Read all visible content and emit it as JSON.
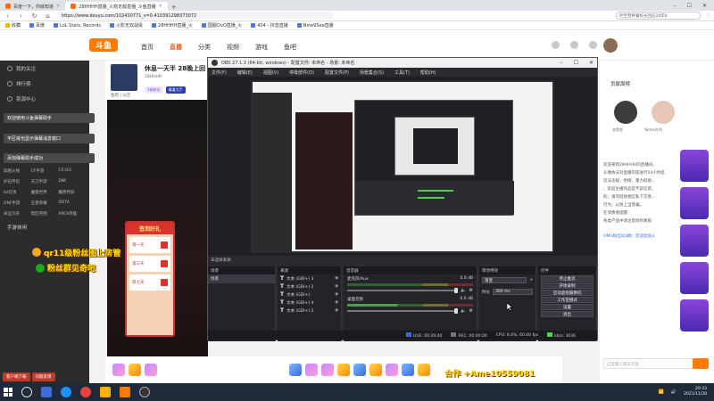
{
  "browser": {
    "tabs": [
      {
        "label": "百度一下，你就知道",
        "active": false
      },
      {
        "label": "28HHHH直播_火箭无敌直播_斗鱼直播",
        "active": true
      }
    ],
    "url": "https://www.douyu.com/102430771_s=0.410391298373072",
    "search_placeholder": "时至营养餐校长回应20年6",
    "bookmarks": [
      "收藏",
      "百度",
      "LoL Stats, Records",
      "火影无双战役",
      "28HHHH直播_火",
      "国服OvO直播_火",
      "404 - 抖音直播",
      "Nine95ee直播"
    ]
  },
  "site": {
    "logo": "斗鱼",
    "nav": [
      {
        "label": "首页",
        "active": false
      },
      {
        "label": "直播",
        "active": true
      },
      {
        "label": "分类",
        "active": false
      },
      {
        "label": "视频",
        "active": false
      },
      {
        "label": "游戏",
        "active": false
      },
      {
        "label": "鱼吧",
        "active": false
      }
    ]
  },
  "sidebar": {
    "items": [
      "我的关注",
      "排行榜",
      "资源中心"
    ],
    "toasts": [
      "欢迎使用斗鱼弹幕助手",
      "平区域也显示弹幕消息窗口",
      "添加弹幕助手成功"
    ],
    "categories": [
      "英雄联盟",
      "和平精英",
      "DOTA2",
      "穿越火线",
      "CF手游",
      "CS:GO",
      "炉石传说",
      "天刀手游",
      "DNF",
      "lol云顶",
      "魔兽世界",
      "魔兽怀旧",
      "DNF手游",
      "王者荣耀",
      "DOTA",
      "命运方舟",
      "暗区突围",
      "APEX英雄"
    ],
    "section_label": "手游休闲",
    "bottom_buttons": [
      "客户端下载",
      "问题反馈"
    ]
  },
  "stream": {
    "title": "休息一天半 28晚上回",
    "subtitle": "鱼吧 | 公告",
    "streamer": "28HHHH",
    "tags": [
      "5级粉丝",
      "福道大厅"
    ]
  },
  "overlay": {
    "gift_title": "签到好礼",
    "gift_rows": [
      "第一天",
      "第三天",
      "第七天"
    ],
    "line1": "qr11级粉丝图上房管",
    "line2": "粉丝群见奇吧",
    "bottom_promo": "合作 +Ame10559081"
  },
  "right_panel": {
    "rank_title": "贡献周榜",
    "rank_names": [
      "苏鱼鱼",
      "Yonna方叫"
    ],
    "chat_lines": [
      "欢迎来到28HHHH的直播间，",
      "头像依法对直播内容进行24小时巡",
      "违法违规、色情、暴力低俗…",
      "、欢迎主播作品是不良信息，",
      "的，请勿轻易相信私下交易…",
      "行为，以防上当受骗。",
      "在消费者提醒：",
      "各类产品中请注意辨别真假",
      "OMG粉丝QQ群：欢迎您加入"
    ],
    "input_placeholder": "这里输入聊天内容"
  },
  "obs": {
    "title": "OBS 27.1.3 (64-bit, windows) - 配置文件: 未命名 - 场景: 未命名",
    "menu": [
      "文件(F)",
      "编辑(E)",
      "视图(V)",
      "停靠部件(D)",
      "配置文件(P)",
      "场景集合(S)",
      "工具(T)",
      "帮助(H)"
    ],
    "panels": {
      "scenes": {
        "title": "场景",
        "items": [
          "场景"
        ]
      },
      "sources": {
        "title": "来源",
        "items": [
          "文本 (GDI+) 3",
          "文本 (GDI+) 2",
          "文本 (GDI+)",
          "文本 (GDI+) 4",
          "文本 (GDI+) 5"
        ]
      },
      "mixer": {
        "title": "混音器",
        "tracks": [
          {
            "name": "麦克风/Aux",
            "db": "0.0 dB"
          },
          {
            "name": "桌面音频",
            "db": "0.0 dB"
          }
        ]
      },
      "transitions": {
        "title": "转场特效",
        "type": "渐变",
        "duration_label": "时长",
        "duration": "300 ms"
      },
      "controls": {
        "title": "控件",
        "buttons": [
          "停止推流",
          "开始录制",
          "启动虚拟摄像机",
          "工作室模式",
          "设置",
          "退出"
        ]
      }
    },
    "no_source": "未选择来源",
    "status": {
      "live_label": "LIVE:",
      "live_time": "00:26:40",
      "rec_label": "REC:",
      "rec_time": "00:00:00",
      "cpu": "CPU: 8.4%, 60.00 fps",
      "kbps": "kb/s: 3036"
    }
  },
  "taskbar": {
    "time": "20:33",
    "date": "2021/11/28"
  }
}
